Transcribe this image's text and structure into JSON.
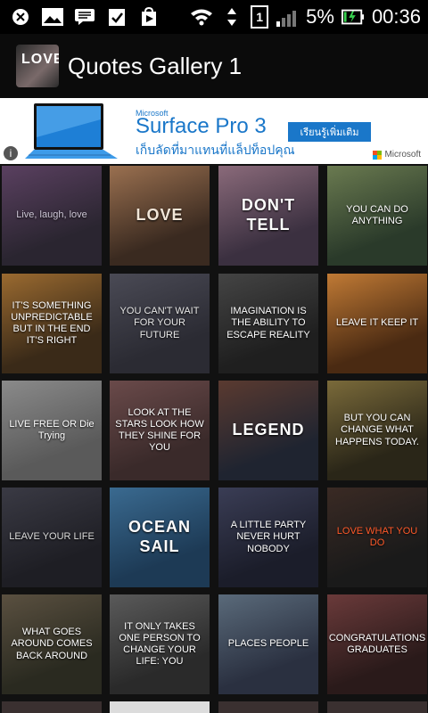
{
  "status": {
    "battery": "5%",
    "time": "00:36",
    "sim": "1",
    "icons": [
      "close-icon",
      "image-icon",
      "message-icon",
      "clipboard-check-icon",
      "play-store-icon"
    ]
  },
  "app": {
    "title": "Quotes Gallery 1",
    "icon_text": "LOVE"
  },
  "ad": {
    "brand_small": "Microsoft",
    "brand": "Surface Pro 3",
    "thai": "เก็บลัดที่มาแทนที่แล็ปท็อปคุณ",
    "button": "เรียนรู้เพิ่มเติม",
    "ms_label": "Microsoft"
  },
  "tiles": [
    {
      "text": "Live, laugh, love",
      "bg": "#2a2530",
      "fg": "#cfc8d8",
      "accent": "#5a4060"
    },
    {
      "text": "LOVE",
      "bg": "#3a2a20",
      "fg": "#f2e6d8",
      "accent": "#9a7050"
    },
    {
      "text": "DON'T TELL",
      "bg": "#3b3040",
      "fg": "#ffffff",
      "accent": "#8a6a7a"
    },
    {
      "text": "YOU CAN DO ANYTHING",
      "bg": "#2a3a2a",
      "fg": "#ffffff",
      "accent": "#6a7a50"
    },
    {
      "text": "IT'S SOMETHING UNPREDICTABLE BUT IN THE END IT'S RIGHT",
      "bg": "#3a2a18",
      "fg": "#ffffff",
      "accent": "#9a6a30"
    },
    {
      "text": "YOU CAN'T WAIT FOR YOUR FUTURE",
      "bg": "#2b2b33",
      "fg": "#e8e8e8",
      "accent": "#4a4a55"
    },
    {
      "text": "IMAGINATION IS THE ABILITY TO ESCAPE REALITY",
      "bg": "#1f1f1f",
      "fg": "#ffffff",
      "accent": "#444444"
    },
    {
      "text": "LEAVE IT KEEP IT",
      "bg": "#4a2a12",
      "fg": "#ffffff",
      "accent": "#c07a35"
    },
    {
      "text": "LIVE FREE OR Die Trying",
      "bg": "#5a5a5a",
      "fg": "#ffffff",
      "accent": "#8a8a8a"
    },
    {
      "text": "LOOK AT THE STARS LOOK HOW THEY SHINE FOR YOU",
      "bg": "#3a2a2a",
      "fg": "#ffffff",
      "accent": "#6a4a4a"
    },
    {
      "text": "LEGEND",
      "bg": "#1f2430",
      "fg": "#ffffff",
      "accent": "#5a3a30"
    },
    {
      "text": "BUT YOU CAN CHANGE WHAT HAPPENS TODAY.",
      "bg": "#2a2618",
      "fg": "#ffffff",
      "accent": "#7a6a3a"
    },
    {
      "text": "LEAVE YOUR LIFE",
      "bg": "#1e1e24",
      "fg": "#dcdcdc",
      "accent": "#3a3a44"
    },
    {
      "text": "OCEAN SAIL",
      "bg": "#1d3a55",
      "fg": "#ffffff",
      "accent": "#3a6a90"
    },
    {
      "text": "A LITTLE PARTY NEVER HURT NOBODY",
      "bg": "#1b1d2a",
      "fg": "#ffffff",
      "accent": "#3a3d55"
    },
    {
      "text": "LOVE WHAT YOU DO",
      "bg": "#1a1a1a",
      "fg": "#ff5a2a",
      "accent": "#3a2a24"
    },
    {
      "text": "WHAT GOES AROUND COMES BACK AROUND",
      "bg": "#2a2a20",
      "fg": "#ffffff",
      "accent": "#5a5040"
    },
    {
      "text": "IT ONLY TAKES ONE PERSON TO CHANGE YOUR LIFE: YOU",
      "bg": "#2a2a2a",
      "fg": "#ffffff",
      "accent": "#5a5a5a"
    },
    {
      "text": "PLACES PEOPLE",
      "bg": "#2a3040",
      "fg": "#ffffff",
      "accent": "#5a6a7a"
    },
    {
      "text": "CONGRATULATIONS GRADUATES",
      "bg": "#2a1a1a",
      "fg": "#ffffff",
      "accent": "#6a3a3a"
    }
  ]
}
